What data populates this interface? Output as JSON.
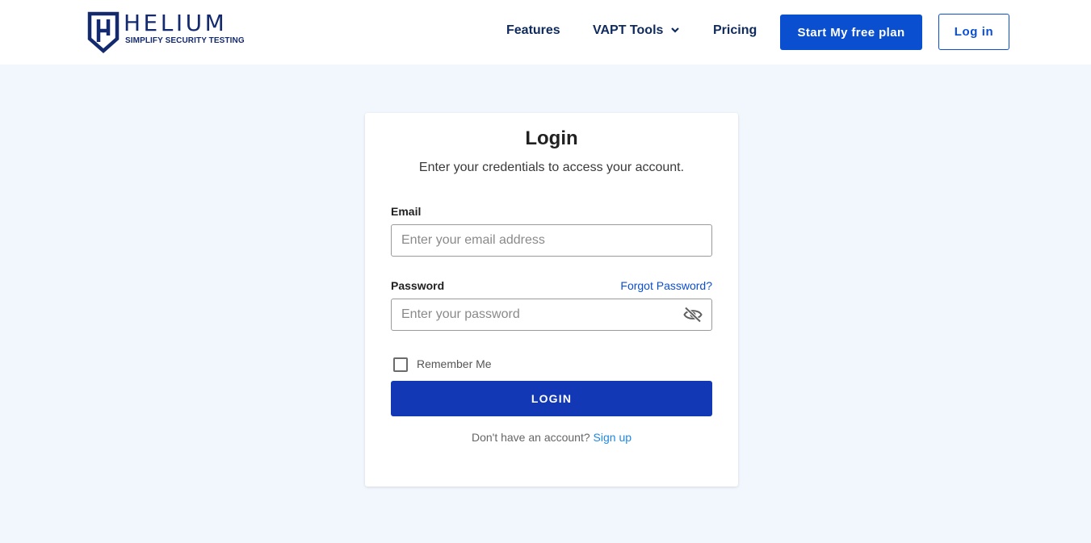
{
  "header": {
    "logo": {
      "word": "HELIUM",
      "tagline": "SIMPLIFY SECURITY TESTING",
      "color": "#142a6e"
    },
    "nav": {
      "features": "Features",
      "vapt_tools": "VAPT Tools",
      "vapt_icon": "chevron-down-icon",
      "pricing": "Pricing"
    },
    "cta_primary": "Start My free plan",
    "cta_secondary": "Log in"
  },
  "login_card": {
    "title": "Login",
    "subtitle": "Enter your credentials to access your account.",
    "email": {
      "label": "Email",
      "placeholder": "Enter your email address",
      "value": ""
    },
    "password": {
      "label": "Password",
      "placeholder": "Enter your password",
      "value": "",
      "toggle_icon": "eye-off-icon"
    },
    "forgot_password": "Forgot Password?",
    "remember_me": {
      "label": "Remember Me",
      "checked": false
    },
    "submit": "LOGIN",
    "signup_prompt": "Don't have an account?",
    "signup_link": "Sign up"
  },
  "colors": {
    "brand_blue": "#0b4fd1",
    "login_button": "#1338b5",
    "link": "#1e88e5",
    "page_bg": "#f2f6fd"
  }
}
